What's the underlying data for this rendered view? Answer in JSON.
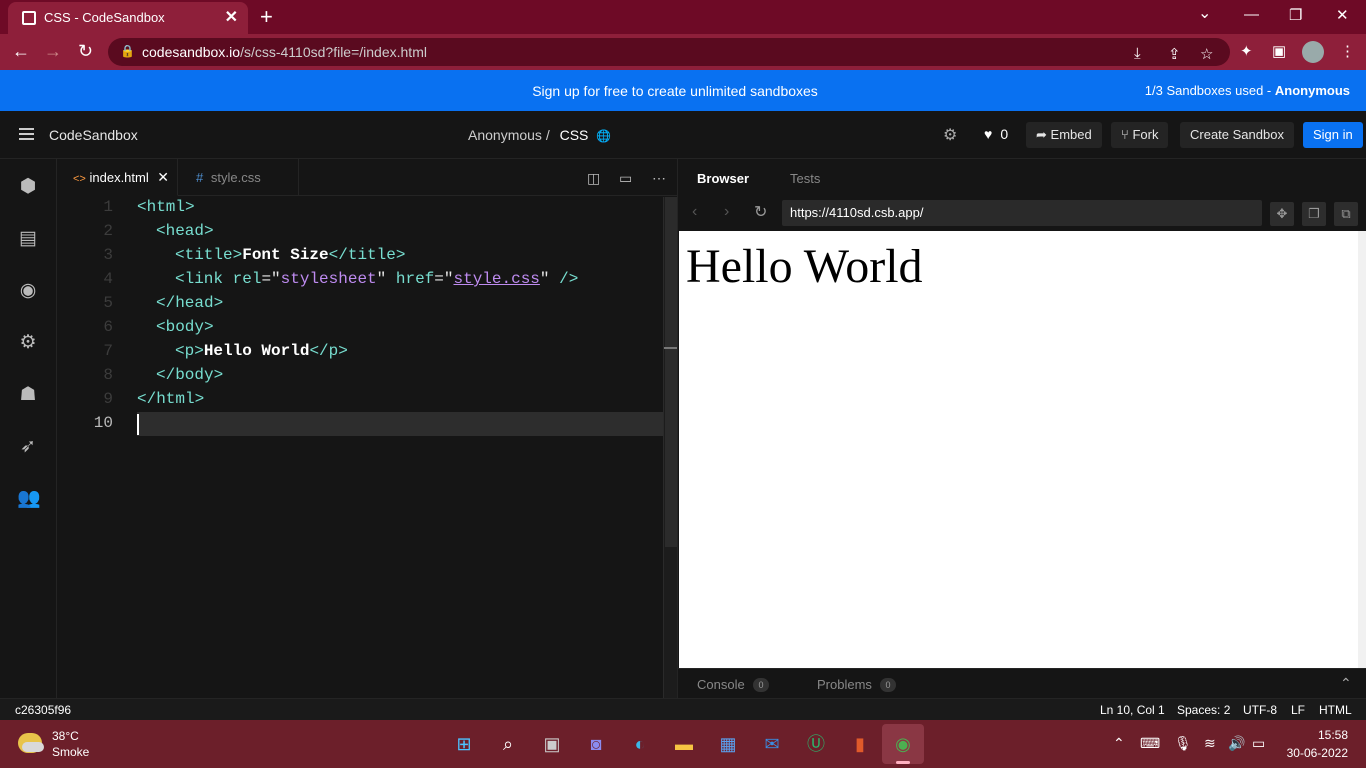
{
  "chrome": {
    "tab_title": "CSS - CodeSandbox",
    "tab_close": "✕",
    "new_tab": "+",
    "url_host": "codesandbox.io",
    "url_path": "/s/css-4110sd?file=/index.html",
    "win_min": "—",
    "win_restore": "❐",
    "win_close": "✕",
    "win_dropdown": "⌄"
  },
  "banner": {
    "message": "Sign up for free to create unlimited sandboxes",
    "used_prefix": "1/3 Sandboxes used -",
    "used_user": "Anonymous"
  },
  "header": {
    "brand": "CodeSandbox",
    "owner": "Anonymous /",
    "sandbox_name": "CSS",
    "likes": "0",
    "embed_label": "Embed",
    "fork_label": "Fork",
    "create_label": "Create Sandbox",
    "signin_label": "Sign in"
  },
  "editor": {
    "tabs": [
      {
        "icon": "<>",
        "label": "index.html",
        "close": "✕"
      },
      {
        "icon": "#",
        "label": "style.css"
      }
    ],
    "line_numbers": [
      "1",
      "2",
      "3",
      "4",
      "5",
      "6",
      "7",
      "8",
      "9",
      "10"
    ],
    "lines": {
      "l1_open": "<html>",
      "l2_open": "<head>",
      "l3_open": "<title>",
      "l3_text": "Font Size",
      "l3_close": "</title>",
      "l4_open": "<link",
      "l4_attr1": "rel",
      "l4_eq1": "=\"",
      "l4_val1": "stylesheet",
      "l4_q1": "\"",
      "l4_attr2": "href",
      "l4_eq2": "=\"",
      "l4_val2": "style.css",
      "l4_q2": "\"",
      "l4_end": "/>",
      "l5_close": "</head>",
      "l6_open": "<body>",
      "l7_open": "<p>",
      "l7_text": "Hello World",
      "l7_close": "</p>",
      "l8_close": "</body>",
      "l9_close": "</html>"
    }
  },
  "browser": {
    "tab_browser": "Browser",
    "tab_tests": "Tests",
    "url": "https://4110sd.csb.app/",
    "content_text": "Hello World",
    "console_label": "Console",
    "console_count": "0",
    "problems_label": "Problems",
    "problems_count": "0"
  },
  "status": {
    "commit": "c26305f96",
    "position": "Ln 10, Col 1",
    "spaces": "Spaces: 2",
    "encoding": "UTF-8",
    "eol": "LF",
    "language": "HTML"
  },
  "taskbar": {
    "temperature": "38°C",
    "condition": "Smoke",
    "time": "15:58",
    "date": "30-06-2022"
  }
}
